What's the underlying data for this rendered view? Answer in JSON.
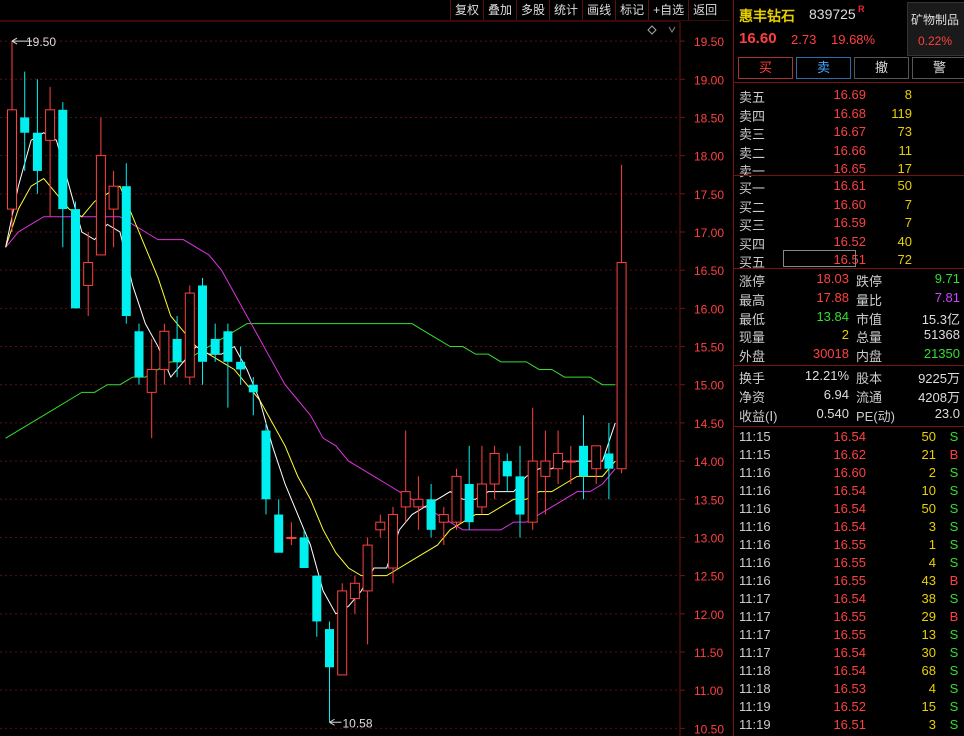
{
  "toolbar": [
    "复权",
    "叠加",
    "多股",
    "统计",
    "画线",
    "标记",
    "+自选",
    "返回"
  ],
  "stock": {
    "name": "惠丰钻石",
    "code": "839725",
    "flag": "R",
    "price": "16.60",
    "change": "2.73",
    "change_pct": "19.68%"
  },
  "sector": {
    "name": "矿物制品",
    "pct": "0.22%"
  },
  "buttons": {
    "buy": "买",
    "sell": "卖",
    "cancel": "撤",
    "alert": "警"
  },
  "asks": [
    {
      "label": "卖五",
      "price": "16.69",
      "vol": "8"
    },
    {
      "label": "卖四",
      "price": "16.68",
      "vol": "119"
    },
    {
      "label": "卖三",
      "price": "16.67",
      "vol": "73"
    },
    {
      "label": "卖二",
      "price": "16.66",
      "vol": "11"
    },
    {
      "label": "卖一",
      "price": "16.65",
      "vol": "17"
    }
  ],
  "bids": [
    {
      "label": "买一",
      "price": "16.61",
      "vol": "50"
    },
    {
      "label": "买二",
      "price": "16.60",
      "vol": "7"
    },
    {
      "label": "买三",
      "price": "16.59",
      "vol": "7"
    },
    {
      "label": "买四",
      "price": "16.52",
      "vol": "40"
    },
    {
      "label": "买五",
      "price": "16.51",
      "vol": "72"
    }
  ],
  "stats": [
    {
      "l1": "涨停",
      "v1": "18.03",
      "c1": "#ff4040",
      "l2": "跌停",
      "v2": "9.71",
      "c2": "#33dd33"
    },
    {
      "l1": "最高",
      "v1": "17.88",
      "c1": "#ff4040",
      "l2": "量比",
      "v2": "7.81",
      "c2": "#cc44ff"
    },
    {
      "l1": "最低",
      "v1": "13.84",
      "c1": "#33dd33",
      "l2": "市值",
      "v2": "15.3亿",
      "c2": "#ddd"
    },
    {
      "l1": "现量",
      "v1": "2",
      "c1": "#e8d000",
      "l2": "总量",
      "v2": "51368",
      "c2": "#ddd"
    },
    {
      "l1": "外盘",
      "v1": "30018",
      "c1": "#ff4040",
      "l2": "内盘",
      "v2": "21350",
      "c2": "#33dd33"
    }
  ],
  "fund": [
    {
      "l1": "换手",
      "v1": "12.21%",
      "l2": "股本",
      "v2": "9225万"
    },
    {
      "l1": "净资",
      "v1": "6.94",
      "l2": "流通",
      "v2": "4208万"
    },
    {
      "l1": "收益(Ⅰ)",
      "v1": "0.540",
      "l2": "PE(动)",
      "v2": "23.0"
    }
  ],
  "ticks": [
    {
      "t": "11:15",
      "p": "16.54",
      "v": "50",
      "s": "S"
    },
    {
      "t": "11:15",
      "p": "16.62",
      "v": "21",
      "s": "B"
    },
    {
      "t": "11:16",
      "p": "16.60",
      "v": "2",
      "s": "S"
    },
    {
      "t": "11:16",
      "p": "16.54",
      "v": "10",
      "s": "S"
    },
    {
      "t": "11:16",
      "p": "16.54",
      "v": "50",
      "s": "S"
    },
    {
      "t": "11:16",
      "p": "16.54",
      "v": "3",
      "s": "S"
    },
    {
      "t": "11:16",
      "p": "16.55",
      "v": "1",
      "s": "S"
    },
    {
      "t": "11:16",
      "p": "16.55",
      "v": "4",
      "s": "S"
    },
    {
      "t": "11:16",
      "p": "16.55",
      "v": "43",
      "s": "B"
    },
    {
      "t": "11:17",
      "p": "16.54",
      "v": "38",
      "s": "S"
    },
    {
      "t": "11:17",
      "p": "16.55",
      "v": "29",
      "s": "B"
    },
    {
      "t": "11:17",
      "p": "16.55",
      "v": "13",
      "s": "S"
    },
    {
      "t": "11:17",
      "p": "16.54",
      "v": "30",
      "s": "S"
    },
    {
      "t": "11:18",
      "p": "16.54",
      "v": "68",
      "s": "S"
    },
    {
      "t": "11:18",
      "p": "16.53",
      "v": "4",
      "s": "S"
    },
    {
      "t": "11:19",
      "p": "16.52",
      "v": "15",
      "s": "S"
    },
    {
      "t": "11:19",
      "p": "16.51",
      "v": "3",
      "s": "S"
    }
  ],
  "colors": {
    "up": "#ff4040",
    "down": "#00f0f0",
    "ma5": "#ffffff",
    "ma10": "#ffff33",
    "ma20": "#dd33dd",
    "ma60": "#33dd33",
    "sell_tag": "#33dd33",
    "buy_tag": "#ff4040"
  },
  "chart_data": {
    "type": "candlestick",
    "ylim": [
      10.4,
      19.75
    ],
    "yticks": [
      "19.50",
      "19.00",
      "18.50",
      "18.00",
      "17.50",
      "17.00",
      "16.50",
      "16.00",
      "15.50",
      "15.00",
      "14.50",
      "14.00",
      "13.50",
      "13.00",
      "12.50",
      "12.00",
      "11.50",
      "11.00",
      "10.50"
    ],
    "annotations": [
      {
        "text": "19.50"
      },
      {
        "text": "10.58"
      }
    ],
    "candles": [
      {
        "o": 17.3,
        "h": 19.5,
        "l": 17.0,
        "c": 18.6
      },
      {
        "o": 18.5,
        "h": 19.1,
        "l": 17.8,
        "c": 18.3
      },
      {
        "o": 18.3,
        "h": 19.0,
        "l": 17.5,
        "c": 17.8
      },
      {
        "o": 18.2,
        "h": 18.9,
        "l": 17.2,
        "c": 18.6
      },
      {
        "o": 18.6,
        "h": 18.7,
        "l": 16.8,
        "c": 17.3
      },
      {
        "o": 17.3,
        "h": 17.4,
        "l": 16.0,
        "c": 16.0
      },
      {
        "o": 16.3,
        "h": 17.0,
        "l": 15.9,
        "c": 16.6
      },
      {
        "o": 16.7,
        "h": 18.5,
        "l": 16.7,
        "c": 18.0
      },
      {
        "o": 17.3,
        "h": 17.8,
        "l": 16.8,
        "c": 17.6
      },
      {
        "o": 17.6,
        "h": 17.9,
        "l": 15.8,
        "c": 15.9
      },
      {
        "o": 15.7,
        "h": 15.8,
        "l": 15.0,
        "c": 15.1
      },
      {
        "o": 14.9,
        "h": 15.6,
        "l": 14.3,
        "c": 15.2
      },
      {
        "o": 15.2,
        "h": 15.8,
        "l": 15.0,
        "c": 15.7
      },
      {
        "o": 15.6,
        "h": 15.9,
        "l": 15.1,
        "c": 15.3
      },
      {
        "o": 15.1,
        "h": 16.3,
        "l": 15.0,
        "c": 16.2
      },
      {
        "o": 16.3,
        "h": 16.4,
        "l": 15.0,
        "c": 15.3
      },
      {
        "o": 15.6,
        "h": 15.8,
        "l": 15.3,
        "c": 15.4
      },
      {
        "o": 15.7,
        "h": 15.8,
        "l": 14.7,
        "c": 15.3
      },
      {
        "o": 15.3,
        "h": 15.5,
        "l": 15.0,
        "c": 15.2
      },
      {
        "o": 15.0,
        "h": 15.1,
        "l": 14.6,
        "c": 14.9
      },
      {
        "o": 14.4,
        "h": 14.5,
        "l": 13.3,
        "c": 13.5
      },
      {
        "o": 13.3,
        "h": 13.5,
        "l": 12.9,
        "c": 12.8
      },
      {
        "o": 13.0,
        "h": 13.2,
        "l": 12.9,
        "c": 13.0
      },
      {
        "o": 13.0,
        "h": 13.1,
        "l": 12.6,
        "c": 12.6
      },
      {
        "o": 12.5,
        "h": 12.5,
        "l": 11.7,
        "c": 11.9
      },
      {
        "o": 11.8,
        "h": 11.9,
        "l": 10.58,
        "c": 11.3
      },
      {
        "o": 11.2,
        "h": 12.4,
        "l": 11.2,
        "c": 12.3
      },
      {
        "o": 12.2,
        "h": 12.5,
        "l": 12.0,
        "c": 12.4
      },
      {
        "o": 12.3,
        "h": 13.0,
        "l": 11.6,
        "c": 12.9
      },
      {
        "o": 13.1,
        "h": 13.3,
        "l": 13.0,
        "c": 13.2
      },
      {
        "o": 12.6,
        "h": 13.4,
        "l": 12.4,
        "c": 13.3
      },
      {
        "o": 13.4,
        "h": 14.4,
        "l": 13.2,
        "c": 13.6
      },
      {
        "o": 13.4,
        "h": 13.8,
        "l": 13.1,
        "c": 13.5
      },
      {
        "o": 13.5,
        "h": 13.7,
        "l": 13.0,
        "c": 13.1
      },
      {
        "o": 13.2,
        "h": 13.4,
        "l": 12.9,
        "c": 13.3
      },
      {
        "o": 13.2,
        "h": 13.9,
        "l": 13.1,
        "c": 13.8
      },
      {
        "o": 13.7,
        "h": 14.2,
        "l": 13.1,
        "c": 13.2
      },
      {
        "o": 13.4,
        "h": 14.2,
        "l": 13.3,
        "c": 13.7
      },
      {
        "o": 13.7,
        "h": 14.2,
        "l": 13.5,
        "c": 14.1
      },
      {
        "o": 14.0,
        "h": 14.1,
        "l": 13.6,
        "c": 13.8
      },
      {
        "o": 13.8,
        "h": 14.2,
        "l": 13.0,
        "c": 13.3
      },
      {
        "o": 13.2,
        "h": 14.7,
        "l": 13.1,
        "c": 14.0
      },
      {
        "o": 13.8,
        "h": 14.4,
        "l": 13.3,
        "c": 14.0
      },
      {
        "o": 13.9,
        "h": 14.4,
        "l": 13.7,
        "c": 14.1
      },
      {
        "o": 14.0,
        "h": 14.2,
        "l": 13.7,
        "c": 14.0
      },
      {
        "o": 14.2,
        "h": 14.6,
        "l": 13.5,
        "c": 13.8
      },
      {
        "o": 13.9,
        "h": 14.1,
        "l": 13.7,
        "c": 14.2
      },
      {
        "o": 14.1,
        "h": 14.5,
        "l": 13.5,
        "c": 13.9
      },
      {
        "o": 13.9,
        "h": 17.88,
        "l": 13.84,
        "c": 16.6
      }
    ],
    "ma5": [
      16.8,
      17.6,
      18.2,
      18.3,
      18.2,
      17.6,
      17.0,
      16.9,
      17.1,
      17.0,
      16.3,
      15.8,
      15.5,
      15.1,
      15.3,
      15.5,
      15.4,
      15.4,
      15.5,
      15.2,
      14.8,
      14.2,
      13.7,
      13.3,
      12.9,
      12.3,
      12.0,
      12.1,
      12.3,
      12.6,
      12.6,
      13.1,
      13.3,
      13.4,
      13.5,
      13.6,
      13.5,
      13.5,
      13.6,
      13.6,
      13.6,
      13.8,
      13.9,
      13.9,
      14.0,
      14.0,
      14.0,
      14.0,
      14.5
    ],
    "ma10": [
      16.8,
      17.3,
      17.6,
      17.7,
      17.5,
      17.3,
      17.2,
      17.4,
      17.5,
      17.6,
      17.2,
      16.8,
      16.4,
      15.9,
      15.7,
      15.5,
      15.4,
      15.3,
      15.2,
      15.0,
      14.8,
      14.5,
      14.2,
      13.8,
      13.5,
      13.1,
      12.8,
      12.6,
      12.5,
      12.5,
      12.5,
      12.6,
      12.7,
      12.8,
      12.9,
      13.1,
      13.2,
      13.3,
      13.3,
      13.4,
      13.5,
      13.5,
      13.6,
      13.6,
      13.7,
      13.8,
      13.8,
      13.8,
      14.0
    ],
    "ma20": [
      16.8,
      17.0,
      17.1,
      17.2,
      17.2,
      17.2,
      17.2,
      17.2,
      17.2,
      17.2,
      17.1,
      17.0,
      16.9,
      16.9,
      16.9,
      16.8,
      16.7,
      16.5,
      16.2,
      15.9,
      15.6,
      15.3,
      15.0,
      14.8,
      14.6,
      14.3,
      14.2,
      14.0,
      13.9,
      13.8,
      13.7,
      13.6,
      13.5,
      13.4,
      13.3,
      13.2,
      13.1,
      13.1,
      13.1,
      13.1,
      13.2,
      13.2,
      13.3,
      13.4,
      13.5,
      13.6,
      13.6,
      13.7,
      13.9
    ],
    "ma60": [
      14.3,
      14.4,
      14.5,
      14.6,
      14.7,
      14.8,
      14.9,
      14.9,
      15.0,
      15.0,
      15.1,
      15.1,
      15.2,
      15.3,
      15.3,
      15.4,
      15.5,
      15.6,
      15.7,
      15.8,
      15.8,
      15.8,
      15.8,
      15.8,
      15.8,
      15.8,
      15.8,
      15.8,
      15.8,
      15.8,
      15.8,
      15.8,
      15.8,
      15.7,
      15.6,
      15.5,
      15.5,
      15.4,
      15.4,
      15.3,
      15.3,
      15.3,
      15.2,
      15.2,
      15.1,
      15.1,
      15.1,
      15.0,
      15.0
    ]
  }
}
